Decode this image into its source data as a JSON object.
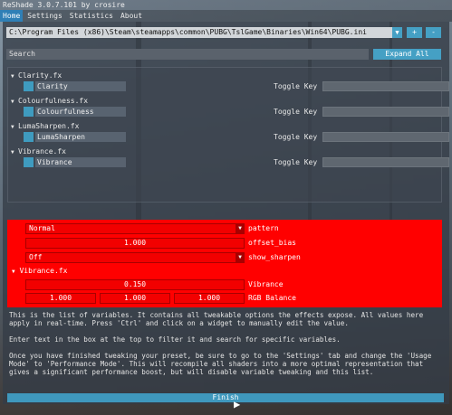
{
  "window": {
    "title": "ReShade 3.0.7.101 by crosire"
  },
  "menu": {
    "items": [
      "Home",
      "Settings",
      "Statistics",
      "About"
    ],
    "active": "Home"
  },
  "preset": {
    "path": "C:\\Program Files (x86)\\Steam\\steamapps\\common\\PUBG\\TslGame\\Binaries\\Win64\\PUBG.ini",
    "add_label": "+",
    "remove_label": "-"
  },
  "search": {
    "placeholder": "Search",
    "expand_all_label": "Expand All"
  },
  "effects": [
    {
      "file": "Clarity.fx",
      "name": "Clarity",
      "toggle_label": "Toggle Key"
    },
    {
      "file": "Colourfulness.fx",
      "name": "Colourfulness",
      "toggle_label": "Toggle Key"
    },
    {
      "file": "LumaSharpen.fx",
      "name": "LumaSharpen",
      "toggle_label": "Toggle Key"
    },
    {
      "file": "Vibrance.fx",
      "name": "Vibrance",
      "toggle_label": "Toggle Key"
    }
  ],
  "variables": {
    "pattern": {
      "value": "Normal",
      "label": "pattern"
    },
    "offset_bias": {
      "value": "1.000",
      "label": "offset_bias"
    },
    "show_sharpen": {
      "value": "Off",
      "label": "show_sharpen"
    },
    "vibrance_section": "Vibrance.fx",
    "vibrance": {
      "value": "0.150",
      "label": "Vibrance"
    },
    "rgb_balance": {
      "values": [
        "1.000",
        "1.000",
        "1.000"
      ],
      "label": "RGB Balance"
    }
  },
  "description": {
    "p1": "This is the list of variables. It contains all tweakable options the effects expose. All values here apply in real-time. Press 'Ctrl' and click on a widget to manually edit the value.",
    "p2": "Enter text in the box at the top to filter it and search for specific variables.",
    "p3": "Once you have finished tweaking your preset, be sure to go to the 'Settings' tab and change the 'Usage Mode' to 'Performance Mode'. This will recompile all shaders into a more optimal representation that gives a significant performance boost, but will disable variable tweaking and this list."
  },
  "finish_label": "Finish",
  "colors": {
    "accent": "#45a0c4",
    "active_tab": "#2f7fb6",
    "variables_bg": "#ff0000"
  }
}
